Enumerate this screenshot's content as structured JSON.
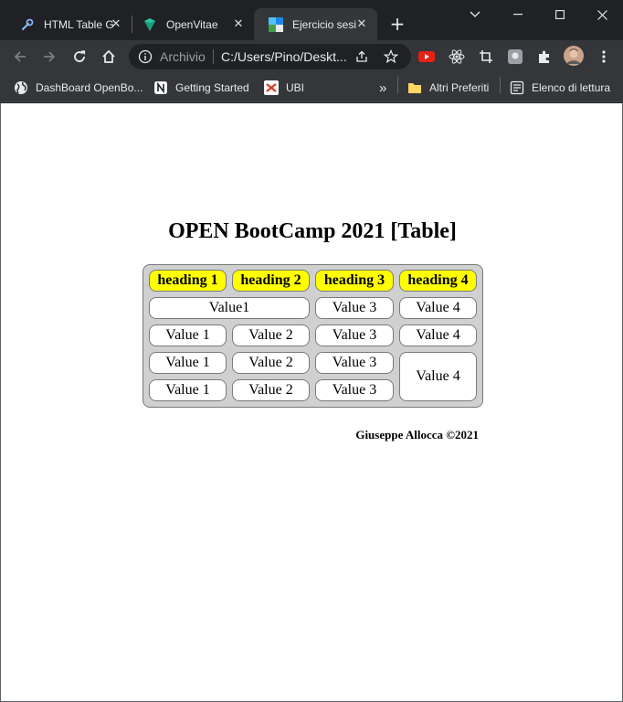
{
  "browser": {
    "tabs": [
      {
        "title": "HTML Table G",
        "favicon": "wrench-icon"
      },
      {
        "title": "OpenVitae",
        "favicon": "openvitae-logo-icon"
      },
      {
        "title": "Ejercicio sesi",
        "favicon": "colorful-square-icon",
        "active": true
      }
    ],
    "address_bar": {
      "scheme_label": "Archivio",
      "url": "C:/Users/Pino/Deskt..."
    },
    "bookmarks": [
      {
        "label": "DashBoard OpenBo...",
        "icon": "globe-icon"
      },
      {
        "label": "Getting Started",
        "icon": "notion-icon"
      },
      {
        "label": "UBI",
        "icon": "ubi-icon"
      }
    ],
    "bookmarks_right": [
      {
        "label": "Altri Preferiti",
        "icon": "folder-icon"
      },
      {
        "label": "Elenco di lettura",
        "icon": "reading-list-icon"
      }
    ],
    "overflow_label": "»"
  },
  "page": {
    "title": "OPEN BootCamp 2021 [Table]",
    "table": {
      "headings": [
        "heading 1",
        "heading 2",
        "heading 3",
        "heading 4"
      ],
      "rows": [
        [
          "Value1",
          "Value 3",
          "Value 4"
        ],
        [
          "Value 1",
          "Value 2",
          "Value 3",
          "Value 4"
        ],
        [
          "Value 1",
          "Value 2",
          "Value 3",
          "Value 4"
        ],
        [
          "Value 1",
          "Value 2",
          "Value 3"
        ]
      ]
    },
    "footer": "Giuseppe Allocca ©2021"
  },
  "colors": {
    "heading_bg": "#ffff00",
    "table_bg": "#d0d0d0",
    "chrome_dark": "#202124",
    "chrome_toolbar": "#35363a"
  }
}
